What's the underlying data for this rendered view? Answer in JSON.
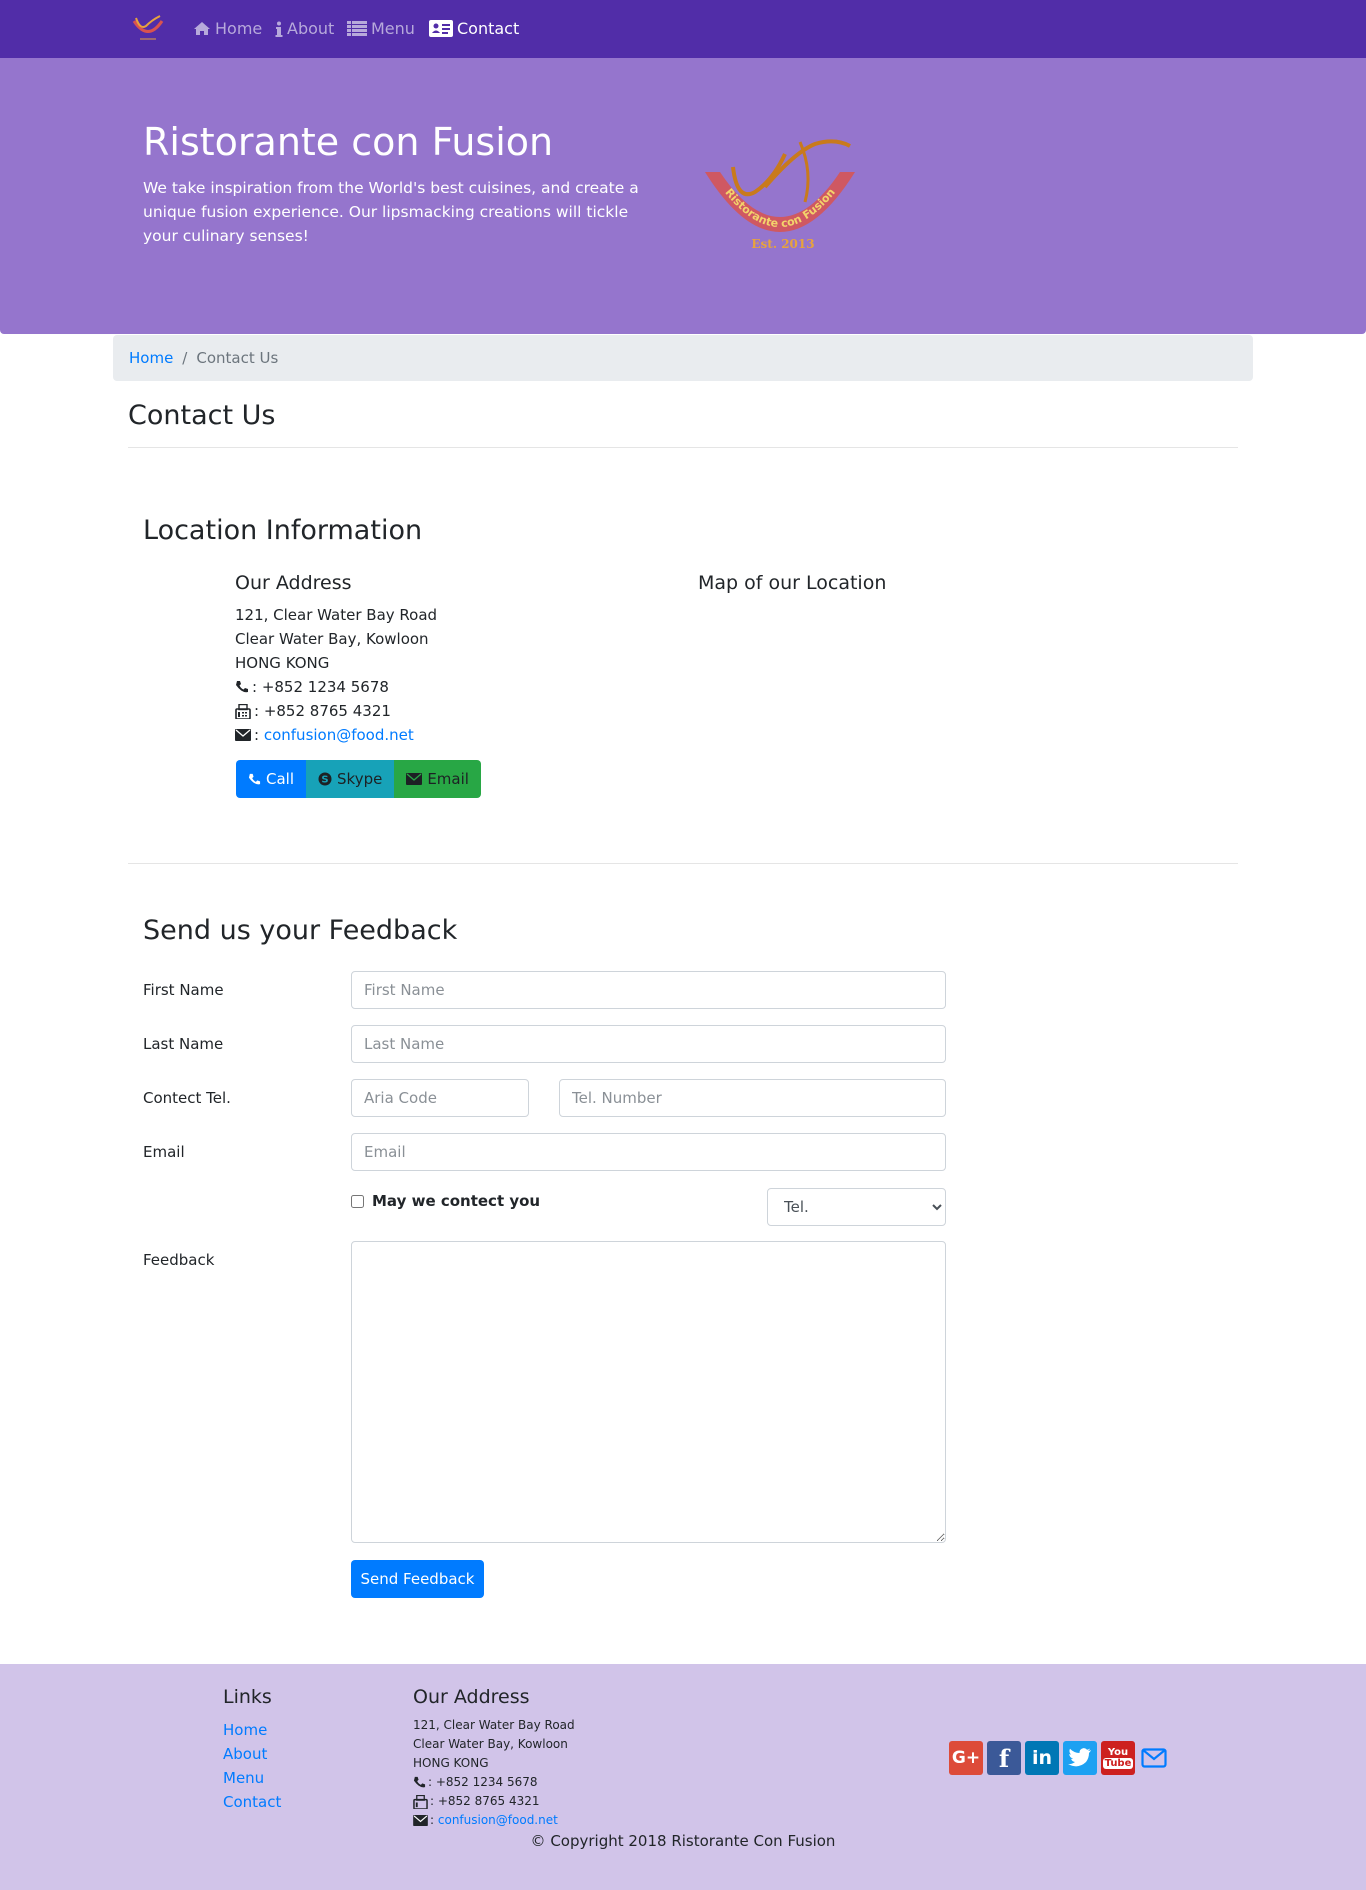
{
  "nav": {
    "items": [
      {
        "label": "Home",
        "icon": "home-icon"
      },
      {
        "label": "About",
        "icon": "info-icon"
      },
      {
        "label": "Menu",
        "icon": "list-icon"
      },
      {
        "label": "Contact",
        "icon": "address-card-icon"
      }
    ],
    "active": "Contact"
  },
  "jumbotron": {
    "title": "Ristorante con Fusion",
    "description": "We take inspiration from the World's best cuisines, and create a unique fusion experience. Our lipsmacking creations will tickle your culinary senses!",
    "logo_text": "Ristorante con Fusion",
    "logo_est": "Est. 2013"
  },
  "breadcrumb": {
    "home": "Home",
    "separator": "/",
    "current": "Contact Us"
  },
  "page_title": "Contact Us",
  "location": {
    "heading": "Location Information",
    "address_heading": "Our Address",
    "address_lines": [
      "121, Clear Water Bay Road",
      "Clear Water Bay, Kowloon",
      "HONG KONG"
    ],
    "phone": ": +852 1234 5678",
    "fax": ": +852 8765 4321",
    "email_prefix": ":",
    "email": "confusion@food.net",
    "map_heading": "Map of our Location",
    "buttons": {
      "call": "Call",
      "skype": "Skype",
      "email": "Email"
    }
  },
  "feedback": {
    "heading": "Send us your Feedback",
    "first_name": {
      "label": "First Name",
      "placeholder": "First Name"
    },
    "last_name": {
      "label": "Last Name",
      "placeholder": "Last Name"
    },
    "tel": {
      "label": "Contect Tel.",
      "area_placeholder": "Aria Code",
      "number_placeholder": "Tel. Number"
    },
    "email": {
      "label": "Email",
      "placeholder": "Email"
    },
    "contact_check": "May we contect you",
    "contact_select": {
      "selected": "Tel."
    },
    "feedback_label": "Feedback",
    "submit": "Send Feedback"
  },
  "footer": {
    "links_heading": "Links",
    "links": [
      "Home",
      "About",
      "Menu",
      "Contact"
    ],
    "address_heading": "Our Address",
    "address_lines": [
      "121, Clear Water Bay Road",
      "Clear Water Bay, Kowloon",
      "HONG KONG"
    ],
    "phone": ": +852 1234 5678",
    "fax": ": +852 8765 4321",
    "email_prefix": ":",
    "email": "confusion@food.net",
    "social": [
      "google-plus-icon",
      "facebook-icon",
      "linkedin-icon",
      "twitter-icon",
      "youtube-icon",
      "envelope-icon"
    ],
    "copyright": "© Copyright 2018 Ristorante Con Fusion"
  },
  "colors": {
    "navbar": "#512da8",
    "jumbotron": "#9575cd",
    "footer": "#d1c4e9",
    "primary": "#007bff",
    "info": "#17a2b8",
    "success": "#28a745"
  }
}
